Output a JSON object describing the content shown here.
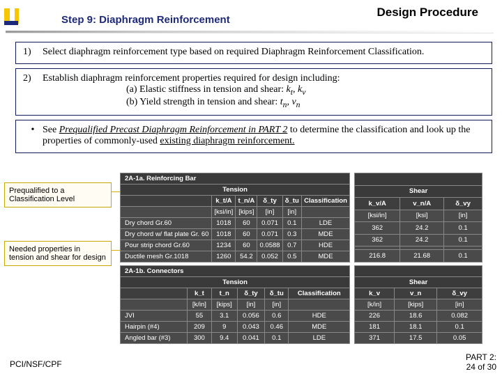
{
  "header": {
    "step": "Step 9: Diaphragm Reinforcement",
    "corner": "Design Procedure"
  },
  "items": {
    "n1": "1)",
    "b1": "Select diaphragm reinforcement type based on required Diaphragm Reinforcement Classification.",
    "n2": "2)",
    "b2": "Establish diaphragm reinforcement properties required for design including:",
    "b2a": "(a) Elastic stiffness in tension and shear: ",
    "b2a_k": "k",
    "b2a_t": "t",
    "b2a_c": ", ",
    "b2a_k2": "k",
    "b2a_v": "v",
    "b2b": "(b) Yield strength in tension and shear: ",
    "b2b_t1": "t",
    "b2b_n": "n",
    "b2b_c": ", ",
    "b2b_v": "v",
    "b2b_n2": "n",
    "bull": "•",
    "b3a": "See ",
    "b3b": "Prequalified Precast Diaphragm Reinforcement in PART 2",
    "b3c": " to determine the classification and look up the properties of commonly-used ",
    "b3d": "existing diaphragm reinforcement.",
    "cap1": "Prequalified to a Classification Level",
    "cap2": "Needed properties in tension and shear for design"
  },
  "chart_data": [
    {
      "type": "table",
      "id": "2A-1a",
      "title": "2A-1a. Reinforcing Bar",
      "left": {
        "columns": [
          "",
          "k_t/A",
          "t_n/A",
          "δ_ty",
          "δ_tu",
          "Classification"
        ],
        "units": [
          "",
          "[ksi/in]",
          "[kips]",
          "[in]",
          "[in]",
          ""
        ],
        "rows": [
          [
            "Dry chord Gr.60",
            "1018",
            "60",
            "0.071",
            "0.1",
            "LDE"
          ],
          [
            "Dry chord w/ flat plate Gr. 60",
            "1018",
            "60",
            "0.071",
            "0.3",
            "MDE"
          ],
          [
            "Pour strip chord Gr.60",
            "1234",
            "60",
            "0.0588",
            "0.7",
            "HDE"
          ],
          [
            "Ductile mesh Gr.1018",
            "1260",
            "54.2",
            "0.052",
            "0.5",
            "MDE"
          ]
        ]
      },
      "right": {
        "columns": [
          "k_v/A",
          "v_n/A",
          "δ_vy"
        ],
        "units": [
          "[ksi/in]",
          "[ksi]",
          "[in]"
        ],
        "rows": [
          [
            "362",
            "24.2",
            "0.1"
          ],
          [
            "362",
            "24.2",
            "0.1"
          ],
          [
            "",
            "",
            ""
          ],
          [
            "216.8",
            "21.68",
            "0.1"
          ]
        ]
      }
    },
    {
      "type": "table",
      "id": "2A-1b",
      "title": "2A-1b. Connectors",
      "left": {
        "columns": [
          "",
          "k_t",
          "t_n",
          "δ_ty",
          "δ_tu",
          "Classification"
        ],
        "units": [
          "",
          "[k/in]",
          "[kips]",
          "[in]",
          "[in]",
          ""
        ],
        "rows": [
          [
            "JVI",
            "55",
            "3.1",
            "0.056",
            "0.6",
            "HDE"
          ],
          [
            "Hairpin (#4)",
            "209",
            "9",
            "0.043",
            "0.46",
            "MDE"
          ],
          [
            "Angled bar (#3)",
            "300",
            "9.4",
            "0.041",
            "0.1",
            "LDE"
          ]
        ]
      },
      "right": {
        "columns": [
          "k_v",
          "v_n",
          "δ_vy"
        ],
        "units": [
          "[k/in]",
          "[kips]",
          "[in]"
        ],
        "rows": [
          [
            "226",
            "18.6",
            "0.082"
          ],
          [
            "181",
            "18.1",
            "0.1"
          ],
          [
            "371",
            "17.5",
            "0.05"
          ]
        ]
      }
    }
  ],
  "footer": {
    "left": "PCI/NSF/CPF",
    "right1": "PART 2:",
    "right2": "24 of 30"
  }
}
